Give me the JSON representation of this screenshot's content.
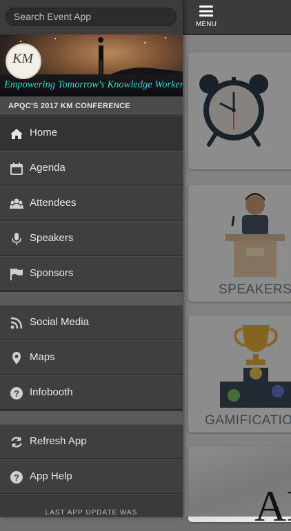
{
  "search": {
    "placeholder": "Search Event App"
  },
  "banner": {
    "logo_text": "KM",
    "logo_ring_text": "APQC'S 2017 KM CONFERENCE",
    "tagline": "Empowering Tomorrow's Knowledge Workers"
  },
  "conference_title": "APQC'S 2017 KM CONFERENCE",
  "nav": {
    "home": "Home",
    "agenda": "Agenda",
    "attendees": "Attendees",
    "speakers": "Speakers",
    "sponsors": "Sponsors",
    "social_media": "Social Media",
    "maps": "Maps",
    "infobooth": "Infobooth",
    "refresh_app": "Refresh App",
    "app_help": "App Help"
  },
  "footer": {
    "last_update": "LAST APP UPDATE WAS"
  },
  "topbar": {
    "menu_label": "MENU"
  },
  "tiles": {
    "speakers_label": "SPEAKERS",
    "gamification_label": "GAMIFICATION",
    "logo_fragment": "AP"
  },
  "colors": {
    "drawer_bg": "#3a3a3a",
    "accent_text": "#6f7f8e",
    "tagline": "#3ed4d4"
  },
  "icons": [
    "home-icon",
    "calendar-icon",
    "users-icon",
    "microphone-icon",
    "flag-icon",
    "rss-icon",
    "map-pin-icon",
    "question-icon",
    "refresh-icon",
    "question-icon"
  ]
}
